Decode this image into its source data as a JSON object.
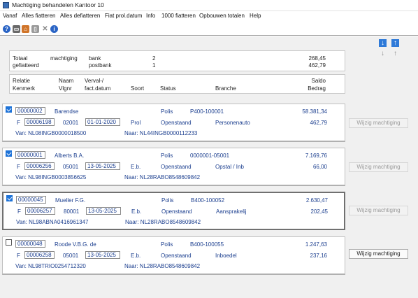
{
  "window": {
    "title": "Machtiging behandelen Kantoor 10"
  },
  "menu": [
    "Vanaf",
    "Alles fiatteren",
    "Alles defiatteren",
    "Fiat prol.datum",
    "Info",
    "1000 fiatteren",
    "Opbouwen totalen",
    "Help"
  ],
  "toolbar_icons": [
    "help-icon",
    "print-icon",
    "home-icon",
    "document-icon",
    "delete-icon",
    "info-icon"
  ],
  "summary": {
    "row1": {
      "label": "Totaal",
      "col2": "machtiging",
      "col3": "bank",
      "count": "2",
      "amount": "268,45"
    },
    "row2": {
      "label": "gefiatteerd",
      "col2": "",
      "col3": "postbank",
      "count": "1",
      "amount": "462,79"
    }
  },
  "headers": {
    "relatie": "Relatie",
    "kenmerk": "Kenmerk",
    "naam": "Naam",
    "vlgnr": "Vlgnr",
    "verval": "Verval-/",
    "factdatum": "fact.datum",
    "soort": "Soort",
    "status": "Status",
    "branche": "Branche",
    "saldo": "Saldo",
    "bedrag": "Bedrag"
  },
  "records": [
    {
      "checked": true,
      "relatie": "00000002",
      "naam": "Barendse",
      "polis_label": "Polis",
      "polis": "P400-100001",
      "saldo": "58.381,34",
      "kenmerk_prefix": "F",
      "kenmerk": "00006198",
      "vlgnr": "02001",
      "datum": "01-01-2020",
      "soort": "Prol",
      "status": "Openstaand",
      "branche": "Personenauto",
      "bedrag": "462,79",
      "van": "Van: NL08INGB0000018500",
      "naar": "Naar: NL44INGB0000112233",
      "button": "Wijzig machtiging",
      "button_enabled": false
    },
    {
      "checked": true,
      "relatie": "00000001",
      "naam": "Alberts B.A.",
      "polis_label": "Polis",
      "polis": "0000001-05001",
      "saldo": "7.169,76",
      "kenmerk_prefix": "F",
      "kenmerk": "00006256",
      "vlgnr": "05001",
      "datum": "13-05-2025",
      "soort": "E.b.",
      "status": "Openstaand",
      "branche": "Opstal / Inb",
      "bedrag": "66,00",
      "van": "Van: NL98INGB0003856625",
      "naar": "Naar: NL28RABO8548609842",
      "button": "Wijzig machtiging",
      "button_enabled": false
    },
    {
      "checked": true,
      "relatie": "00000045",
      "naam": "Mueller F.G.",
      "polis_label": "Polis",
      "polis": "B400-100052",
      "saldo": "2.630,47",
      "kenmerk_prefix": "F",
      "kenmerk": "00006257",
      "vlgnr": "80001",
      "datum": "13-05-2025",
      "soort": "E.b.",
      "status": "Openstaand",
      "branche": "Aansprakelij",
      "bedrag": "202,45",
      "van": "Van: NL98ABNA0416961347",
      "naar": "Naar: NL28RABO8548609842",
      "button": "Wijzig machtiging",
      "button_enabled": false
    },
    {
      "checked": false,
      "relatie": "00000048",
      "naam": "Roode V.B.G. de",
      "polis_label": "Polis",
      "polis": "B400-100055",
      "saldo": "1.247,63",
      "kenmerk_prefix": "F",
      "kenmerk": "00006258",
      "vlgnr": "05001",
      "datum": "13-05-2025",
      "soort": "E.b.",
      "status": "Openstaand",
      "branche": "Inboedel",
      "bedrag": "237,16",
      "van": "Van: NL98TRIO0254712320",
      "naar": "Naar: NL28RABO8548609842",
      "button": "Wijzig machtiging",
      "button_enabled": true
    }
  ],
  "colors": {
    "link_blue": "#1c3f8f",
    "check_blue": "#1e73d8"
  }
}
